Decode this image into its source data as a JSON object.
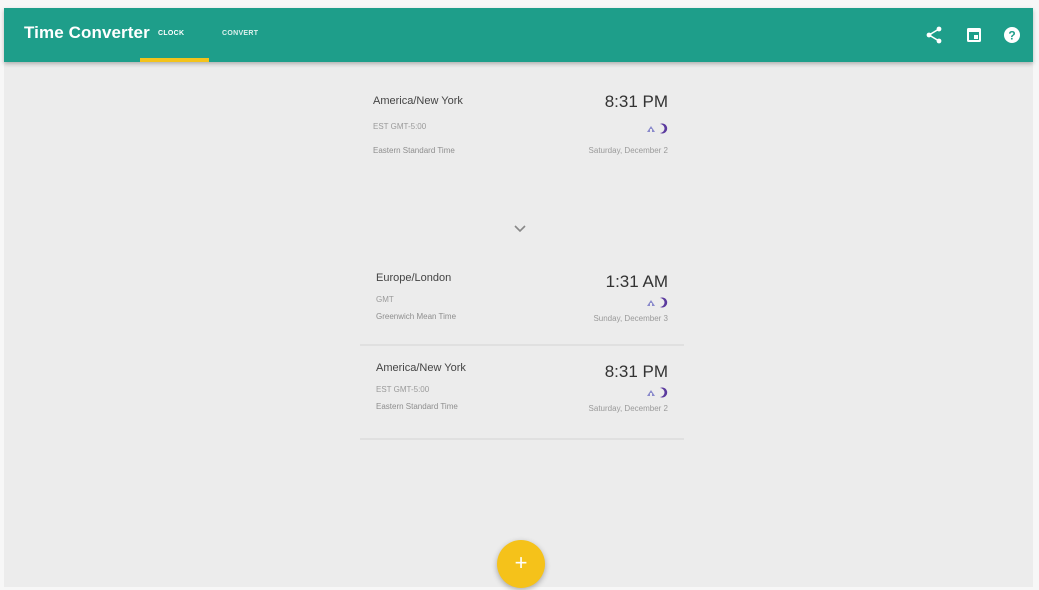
{
  "appbar": {
    "title": "Time Converter",
    "tabs": [
      {
        "label": "CLOCK",
        "active": true
      },
      {
        "label": "CONVERT",
        "active": false
      }
    ],
    "icons": [
      "share-icon",
      "calendar-icon",
      "help-icon"
    ],
    "color": "#1e9e8a",
    "tab_indicator_color": "#f3c31b"
  },
  "source_card": {
    "zone": "America/New York",
    "abbr": "EST GMT-5:00",
    "full_name": "Eastern Standard Time",
    "time": "8:31 PM",
    "date": "Saturday, December 2"
  },
  "converted_cards": [
    {
      "zone": "Europe/London",
      "abbr": "GMT",
      "full_name": "Greenwich Mean Time",
      "time": "1:31 AM",
      "date": "Sunday, December 3"
    },
    {
      "zone": "America/New York",
      "abbr": "EST GMT-5:00",
      "full_name": "Eastern Standard Time",
      "time": "8:31 PM",
      "date": "Saturday, December 2"
    }
  ],
  "fab": {
    "label": "+",
    "color": "#f5c21a"
  }
}
